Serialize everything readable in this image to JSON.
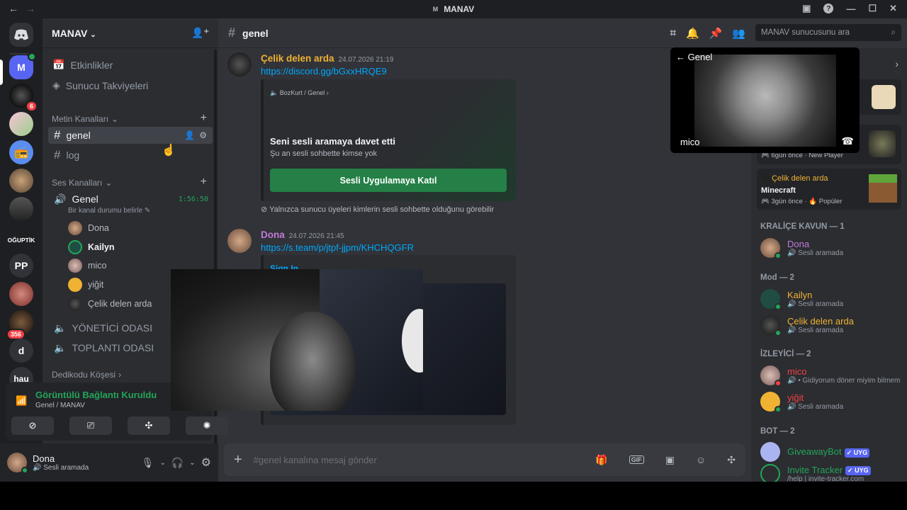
{
  "window": {
    "title": "MANAV",
    "title_icon": "M"
  },
  "colors": {
    "accent": "#5865f2",
    "green": "#23a55a",
    "red": "#f23f43",
    "link": "#00a8fc"
  },
  "rail": {
    "badges": [
      "6",
      "356"
    ],
    "text_servers": [
      "M",
      "OĞUPTİK",
      "PP",
      "d",
      "hau"
    ]
  },
  "guild": {
    "name": "MANAV"
  },
  "sidebar": {
    "events": "Etkinlikler",
    "boosts": "Sunucu Takviyeleri",
    "text_category": "Metin Kanalları",
    "text_channels": [
      "genel",
      "log"
    ],
    "voice_category": "Ses Kanalları",
    "voice_channel": "Genel",
    "voice_timer": "1:56:50",
    "voice_status": "Bir kanal durumu belirle",
    "voice_users": [
      "Dona",
      "Kailyn",
      "mico",
      "yiğit",
      "Çelik delen arda"
    ],
    "other_voice": [
      "YÖNETİCİ ODASI",
      "TOPLANTI ODASI"
    ],
    "gossip_category": "Dedikodu Köşesi"
  },
  "voice_panel": {
    "status": "Görüntülü Bağlantı Kuruldu",
    "location": "Genel / MANAV"
  },
  "user": {
    "name": "Dona",
    "status": "Sesli aramada"
  },
  "chat": {
    "channel": "genel",
    "search_placeholder": "MANAV sunucusunu ara",
    "messages": [
      {
        "author": "Çelik delen arda",
        "time": "24.07.2026 21:19",
        "link": "https://discord.gg/bGxxHRQE9",
        "embed": {
          "source": "BozKurt / Genel",
          "title": "Seni sesli aramaya davet etti",
          "desc": "Şu an sesli sohbette kimse yok",
          "button": "Sesli Uygulamaya Katıl",
          "note": "Yalnızca sunucu üyeleri kimlerin sesli sohbette olduğunu görebilir"
        }
      },
      {
        "author": "Dona",
        "time": "24.07.2026 21:45",
        "link": "https://s.team/p/jtpf-jjpm/KHCHQGFR",
        "embed": {
          "title": "Sign In"
        }
      }
    ],
    "compose_placeholder": "#genel kanalına mesaj gönder"
  },
  "pip": {
    "back_label": "Genel",
    "name": "mico"
  },
  "members": {
    "activities": [
      {
        "time": "6gün önce",
        "tag": "New Player"
      },
      {
        "user": "Çelik delen arda",
        "game": "Minecraft",
        "time": "3gün önce",
        "tag": "Popüler"
      }
    ],
    "groups": [
      {
        "title": "KRALİÇE KAVUN — 1",
        "members": [
          {
            "name": "Dona",
            "color": "#c27ad8",
            "sub": "Sesli aramada"
          }
        ]
      },
      {
        "title": "Mod — 2",
        "members": [
          {
            "name": "Kailyn",
            "color": "#f0b232",
            "sub": "Sesli aramada"
          },
          {
            "name": "Çelik delen arda",
            "color": "#f0b232",
            "sub": "Sesli aramada"
          }
        ]
      },
      {
        "title": "İZLEYİCİ — 2",
        "members": [
          {
            "name": "mico",
            "color": "#f23f43",
            "sub": "• Gidiyorum döner miyim bilmem"
          },
          {
            "name": "yiğit",
            "color": "#f23f43",
            "sub": "Sesli aramada"
          }
        ]
      },
      {
        "title": "BOT — 2",
        "members": [
          {
            "name": "GiveawayBot",
            "color": "#23a55a",
            "tag": "UYG"
          },
          {
            "name": "Invite Tracker",
            "color": "#23a55a",
            "tag": "UYG",
            "sub": "/help | invite-tracker.com"
          }
        ]
      }
    ]
  }
}
